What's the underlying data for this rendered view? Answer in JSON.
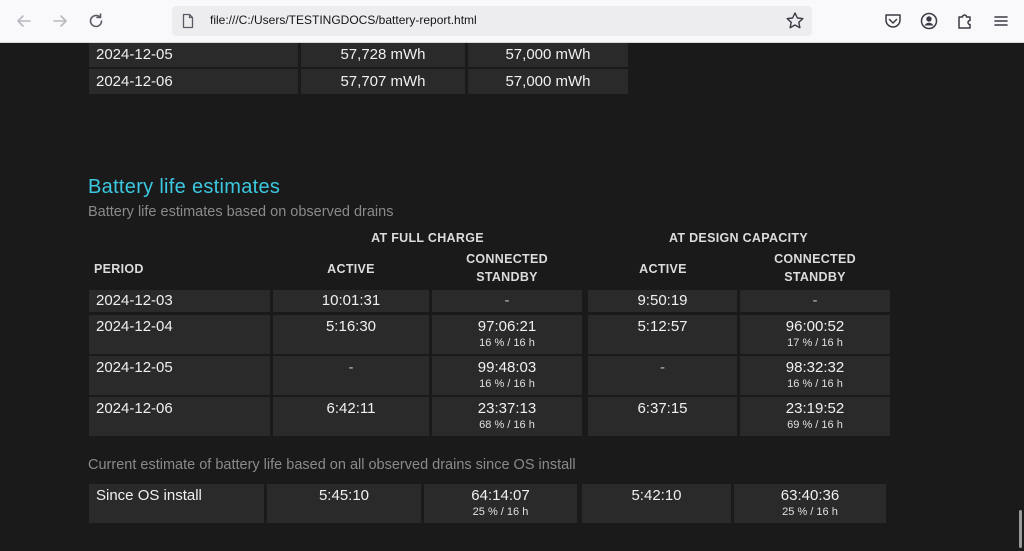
{
  "browser": {
    "url": "file:///C:/Users/TESTINGDOCS/battery-report.html",
    "icons": [
      "back-arrow-icon",
      "forward-arrow-icon",
      "reload-icon",
      "file-icon",
      "star-icon",
      "pocket-icon",
      "account-icon",
      "extensions-icon",
      "menu-icon"
    ]
  },
  "capacity_history": {
    "rows": [
      {
        "date": "2024-12-05",
        "full": "57,728 mWh",
        "design": "57,000 mWh"
      },
      {
        "date": "2024-12-06",
        "full": "57,707 mWh",
        "design": "57,000 mWh"
      }
    ]
  },
  "estimates": {
    "title": "Battery life estimates",
    "subtitle": "Battery life estimates based on observed drains",
    "group_full": "AT FULL CHARGE",
    "group_design": "AT DESIGN CAPACITY",
    "col_period": "PERIOD",
    "col_active": "ACTIVE",
    "col_standby_1": "CONNECTED",
    "col_standby_2": "STANDBY",
    "rows": [
      {
        "period": "2024-12-03",
        "full_active": "10:01:31",
        "full_standby": "-",
        "full_standby_sub": "",
        "design_active": "9:50:19",
        "design_standby": "-",
        "design_standby_sub": ""
      },
      {
        "period": "2024-12-04",
        "full_active": "5:16:30",
        "full_standby": "97:06:21",
        "full_standby_sub": "16 % / 16 h",
        "design_active": "5:12:57",
        "design_standby": "96:00:52",
        "design_standby_sub": "17 % / 16 h"
      },
      {
        "period": "2024-12-05",
        "full_active": "-",
        "full_standby": "99:48:03",
        "full_standby_sub": "16 % / 16 h",
        "design_active": "-",
        "design_standby": "98:32:32",
        "design_standby_sub": "16 % / 16 h"
      },
      {
        "period": "2024-12-06",
        "full_active": "6:42:11",
        "full_standby": "23:37:13",
        "full_standby_sub": "68 % / 16 h",
        "design_active": "6:37:15",
        "design_standby": "23:19:52",
        "design_standby_sub": "69 % / 16 h"
      }
    ]
  },
  "current_estimate": {
    "subtitle": "Current estimate of battery life based on all observed drains since OS install",
    "label": "Since OS install",
    "full_active": "5:45:10",
    "full_standby": "64:14:07",
    "full_standby_sub": "25 % / 16 h",
    "design_active": "5:42:10",
    "design_standby": "63:40:36",
    "design_standby_sub": "25 % / 16 h"
  },
  "colors": {
    "accent": "#3bc8e0",
    "background": "#1a1a1a",
    "cell": "#2a2a2a"
  }
}
